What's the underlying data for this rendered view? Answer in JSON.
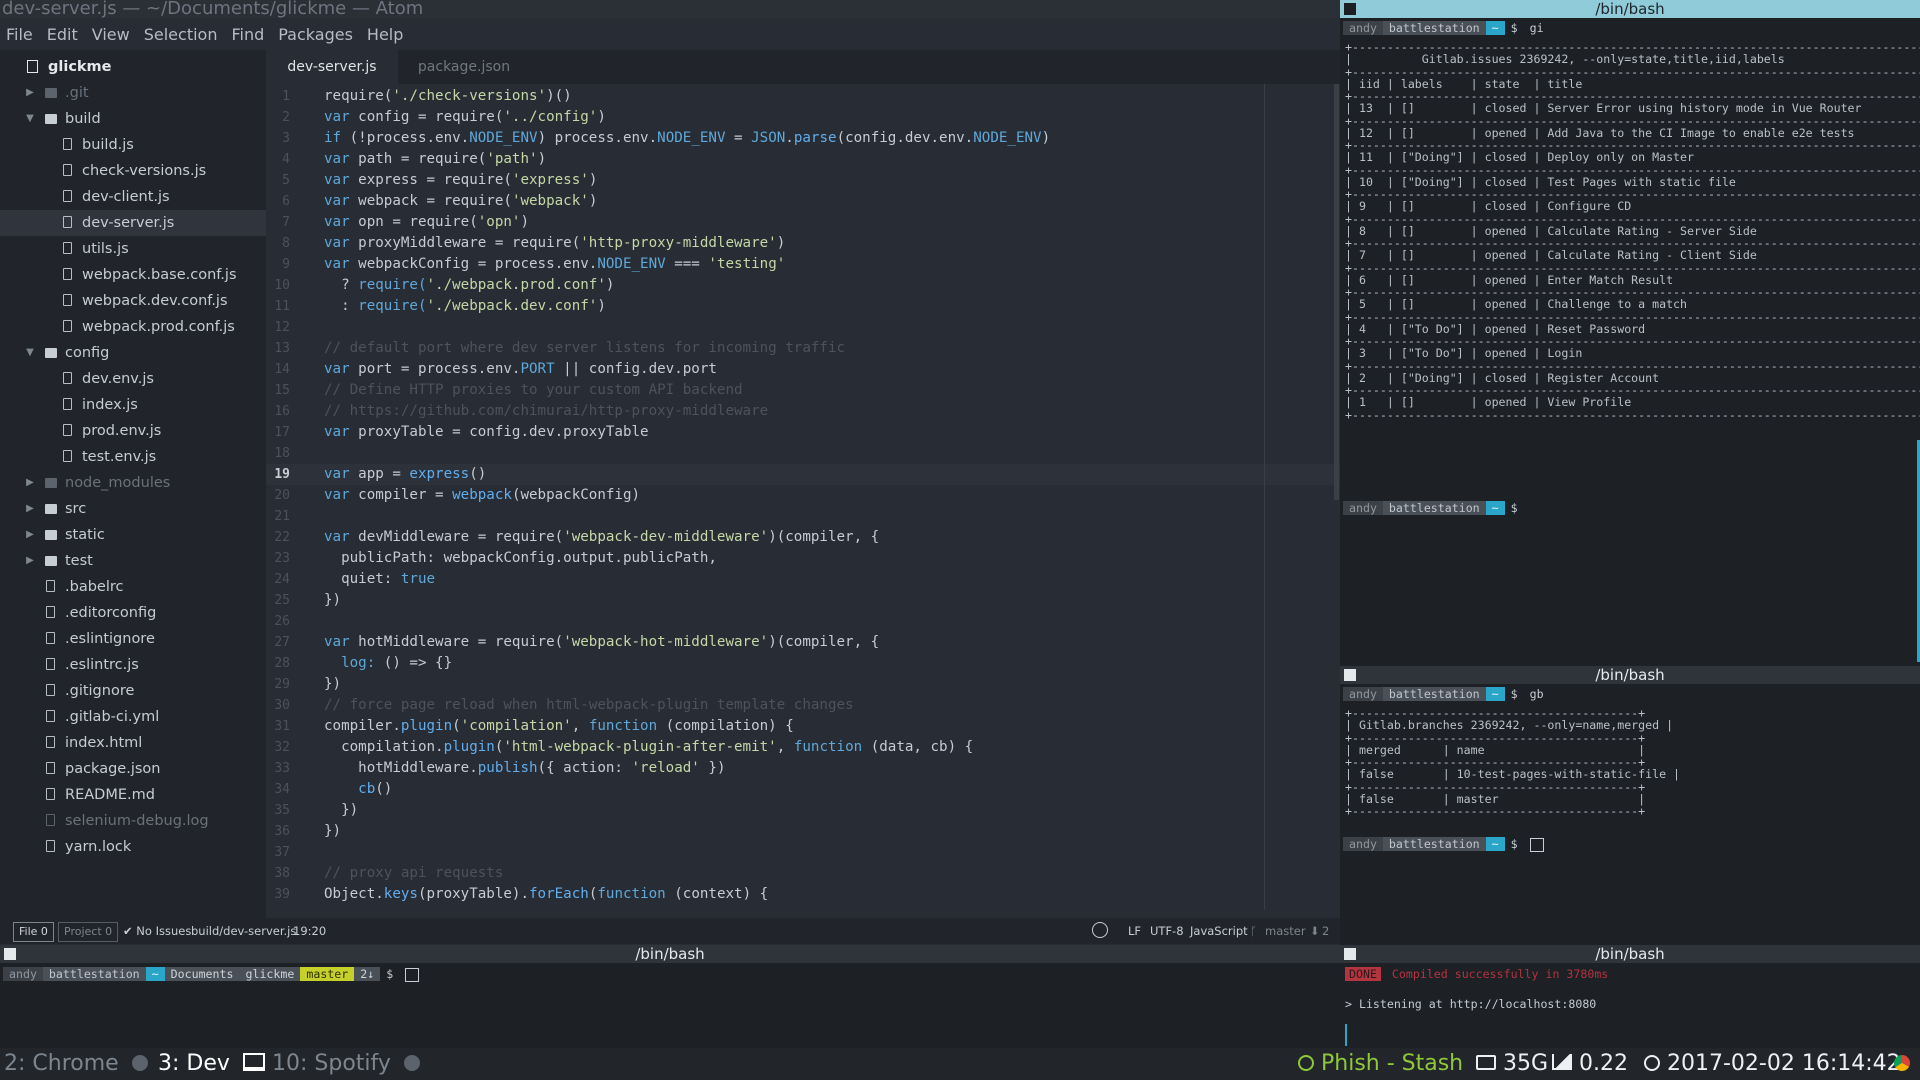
{
  "window": {
    "title": "dev-server.js — ~/Documents/glickme — Atom"
  },
  "menu": [
    "File",
    "Edit",
    "View",
    "Selection",
    "Find",
    "Packages",
    "Help"
  ],
  "tree": {
    "root": "glickme",
    "items": [
      {
        "label": ".git",
        "type": "folder",
        "depth": 1,
        "expanded": false,
        "dim": true
      },
      {
        "label": "build",
        "type": "folder",
        "depth": 1,
        "expanded": true
      },
      {
        "label": "build.js",
        "type": "file",
        "depth": 2
      },
      {
        "label": "check-versions.js",
        "type": "file",
        "depth": 2
      },
      {
        "label": "dev-client.js",
        "type": "file",
        "depth": 2
      },
      {
        "label": "dev-server.js",
        "type": "file",
        "depth": 2,
        "selected": true
      },
      {
        "label": "utils.js",
        "type": "file",
        "depth": 2
      },
      {
        "label": "webpack.base.conf.js",
        "type": "file",
        "depth": 2
      },
      {
        "label": "webpack.dev.conf.js",
        "type": "file",
        "depth": 2
      },
      {
        "label": "webpack.prod.conf.js",
        "type": "file",
        "depth": 2
      },
      {
        "label": "config",
        "type": "folder",
        "depth": 1,
        "expanded": true
      },
      {
        "label": "dev.env.js",
        "type": "file",
        "depth": 2
      },
      {
        "label": "index.js",
        "type": "file",
        "depth": 2
      },
      {
        "label": "prod.env.js",
        "type": "file",
        "depth": 2
      },
      {
        "label": "test.env.js",
        "type": "file",
        "depth": 2
      },
      {
        "label": "node_modules",
        "type": "folder",
        "depth": 1,
        "expanded": false,
        "dim": true
      },
      {
        "label": "src",
        "type": "folder",
        "depth": 1,
        "expanded": false
      },
      {
        "label": "static",
        "type": "folder",
        "depth": 1,
        "expanded": false
      },
      {
        "label": "test",
        "type": "folder",
        "depth": 1,
        "expanded": false
      },
      {
        "label": ".babelrc",
        "type": "file",
        "depth": 1
      },
      {
        "label": ".editorconfig",
        "type": "file",
        "depth": 1
      },
      {
        "label": ".eslintignore",
        "type": "file",
        "depth": 1
      },
      {
        "label": ".eslintrc.js",
        "type": "file",
        "depth": 1
      },
      {
        "label": ".gitignore",
        "type": "file",
        "depth": 1
      },
      {
        "label": ".gitlab-ci.yml",
        "type": "file",
        "depth": 1
      },
      {
        "label": "index.html",
        "type": "file",
        "depth": 1
      },
      {
        "label": "package.json",
        "type": "file",
        "depth": 1
      },
      {
        "label": "README.md",
        "type": "file",
        "depth": 1
      },
      {
        "label": "selenium-debug.log",
        "type": "file",
        "depth": 1,
        "dim": true
      },
      {
        "label": "yarn.lock",
        "type": "file",
        "depth": 1
      }
    ]
  },
  "tabs": [
    {
      "label": "dev-server.js",
      "active": true
    },
    {
      "label": "package.json",
      "active": false
    }
  ],
  "editor": {
    "current_line": 19,
    "lines": [
      [
        [
          "require(",
          "t"
        ],
        [
          "'./check-versions'",
          "s"
        ],
        [
          ")()",
          "t"
        ]
      ],
      [
        [
          "var ",
          "k"
        ],
        [
          "config = ",
          "t"
        ],
        [
          "require(",
          "t"
        ],
        [
          "'../config'",
          "s"
        ],
        [
          ")",
          "t"
        ]
      ],
      [
        [
          "if ",
          "k"
        ],
        [
          "(!process.env.",
          "t"
        ],
        [
          "NODE_ENV",
          "k"
        ],
        [
          ") process.env.",
          "t"
        ],
        [
          "NODE_ENV",
          "k"
        ],
        [
          " = ",
          "t"
        ],
        [
          "JSON",
          "k"
        ],
        [
          ".",
          "t"
        ],
        [
          "parse",
          "g"
        ],
        [
          "(config.dev.env.",
          "t"
        ],
        [
          "NODE_ENV",
          "k"
        ],
        [
          ")",
          "t"
        ]
      ],
      [
        [
          "var ",
          "k"
        ],
        [
          "path = ",
          "t"
        ],
        [
          "require(",
          "t"
        ],
        [
          "'path'",
          "s"
        ],
        [
          ")",
          "t"
        ]
      ],
      [
        [
          "var ",
          "k"
        ],
        [
          "express = ",
          "t"
        ],
        [
          "require(",
          "t"
        ],
        [
          "'express'",
          "s"
        ],
        [
          ")",
          "t"
        ]
      ],
      [
        [
          "var ",
          "k"
        ],
        [
          "webpack = ",
          "t"
        ],
        [
          "require(",
          "t"
        ],
        [
          "'webpack'",
          "s"
        ],
        [
          ")",
          "t"
        ]
      ],
      [
        [
          "var ",
          "k"
        ],
        [
          "opn = ",
          "t"
        ],
        [
          "require(",
          "t"
        ],
        [
          "'opn'",
          "s"
        ],
        [
          ")",
          "t"
        ]
      ],
      [
        [
          "var ",
          "k"
        ],
        [
          "proxyMiddleware = ",
          "t"
        ],
        [
          "require(",
          "t"
        ],
        [
          "'http-proxy-middleware'",
          "s"
        ],
        [
          ")",
          "t"
        ]
      ],
      [
        [
          "var ",
          "k"
        ],
        [
          "webpackConfig = process.env.",
          "t"
        ],
        [
          "NODE_ENV",
          "k"
        ],
        [
          " === ",
          "t"
        ],
        [
          "'testing'",
          "s"
        ]
      ],
      [
        [
          "  ? ",
          "t"
        ],
        [
          "require(",
          "k"
        ],
        [
          "'./webpack.prod.conf'",
          "s"
        ],
        [
          ")",
          "t"
        ]
      ],
      [
        [
          "  : ",
          "t"
        ],
        [
          "require(",
          "k"
        ],
        [
          "'./webpack.dev.conf'",
          "s"
        ],
        [
          ")",
          "t"
        ]
      ],
      [
        [
          "",
          "t"
        ]
      ],
      [
        [
          "// default port where dev server listens for incoming traffic",
          "c"
        ]
      ],
      [
        [
          "var ",
          "k"
        ],
        [
          "port = process.env.",
          "t"
        ],
        [
          "PORT",
          "k"
        ],
        [
          " || config.dev.port",
          "t"
        ]
      ],
      [
        [
          "// Define HTTP proxies to your custom API backend",
          "c"
        ]
      ],
      [
        [
          "// https://github.com/chimurai/http-proxy-middleware",
          "c"
        ]
      ],
      [
        [
          "var ",
          "k"
        ],
        [
          "proxyTable = config.dev.proxyTable",
          "t"
        ]
      ],
      [
        [
          "",
          "t"
        ]
      ],
      [
        [
          "var ",
          "k"
        ],
        [
          "app = ",
          "t"
        ],
        [
          "express",
          "g"
        ],
        [
          "()",
          "t"
        ]
      ],
      [
        [
          "var ",
          "k"
        ],
        [
          "compiler = ",
          "t"
        ],
        [
          "webpack",
          "g"
        ],
        [
          "(webpackConfig)",
          "t"
        ]
      ],
      [
        [
          "",
          "t"
        ]
      ],
      [
        [
          "var ",
          "k"
        ],
        [
          "devMiddleware = ",
          "t"
        ],
        [
          "require(",
          "t"
        ],
        [
          "'webpack-dev-middleware'",
          "s"
        ],
        [
          ")(compiler, {",
          "t"
        ]
      ],
      [
        [
          "  publicPath: webpackConfig.output.publicPath,",
          "t"
        ]
      ],
      [
        [
          "  quiet: ",
          "t"
        ],
        [
          "true",
          "k"
        ]
      ],
      [
        [
          "})",
          "t"
        ]
      ],
      [
        [
          "",
          "t"
        ]
      ],
      [
        [
          "var ",
          "k"
        ],
        [
          "hotMiddleware = ",
          "t"
        ],
        [
          "require(",
          "t"
        ],
        [
          "'webpack-hot-middleware'",
          "s"
        ],
        [
          ")(compiler, {",
          "t"
        ]
      ],
      [
        [
          "  log: ",
          "k"
        ],
        [
          "() => {}",
          "t"
        ]
      ],
      [
        [
          "})",
          "t"
        ]
      ],
      [
        [
          "// force page reload when html-webpack-plugin template changes",
          "c"
        ]
      ],
      [
        [
          "compiler.",
          "t"
        ],
        [
          "plugin",
          "g"
        ],
        [
          "(",
          "t"
        ],
        [
          "'compilation'",
          "s"
        ],
        [
          ", ",
          "t"
        ],
        [
          "function ",
          "k"
        ],
        [
          "(compilation) {",
          "t"
        ]
      ],
      [
        [
          "  compilation.",
          "t"
        ],
        [
          "plugin",
          "g"
        ],
        [
          "(",
          "t"
        ],
        [
          "'html-webpack-plugin-after-emit'",
          "s"
        ],
        [
          ", ",
          "t"
        ],
        [
          "function ",
          "k"
        ],
        [
          "(data, cb) {",
          "t"
        ]
      ],
      [
        [
          "    hotMiddleware.",
          "t"
        ],
        [
          "publish",
          "g"
        ],
        [
          "({ action: ",
          "t"
        ],
        [
          "'reload'",
          "s"
        ],
        [
          " })",
          "t"
        ]
      ],
      [
        [
          "    ",
          "t"
        ],
        [
          "cb",
          "g"
        ],
        [
          "()",
          "t"
        ]
      ],
      [
        [
          "  })",
          "t"
        ]
      ],
      [
        [
          "})",
          "t"
        ]
      ],
      [
        [
          "",
          "t"
        ]
      ],
      [
        [
          "// proxy api requests",
          "c"
        ]
      ],
      [
        [
          "Object.",
          "t"
        ],
        [
          "keys",
          "g"
        ],
        [
          "(proxyTable).",
          "t"
        ],
        [
          "forEach",
          "g"
        ],
        [
          "(",
          "t"
        ],
        [
          "function ",
          "k"
        ],
        [
          "(context) {",
          "t"
        ]
      ]
    ]
  },
  "status": {
    "file_count": "File 0",
    "project_count": "Project 0",
    "issues": "✔ No Issues",
    "path": "build/dev-server.js",
    "cursor": "19:20",
    "eol": "LF",
    "encoding": "UTF-8",
    "grammar": "JavaScript",
    "branch": "master",
    "ahead": "2"
  },
  "term_issues": {
    "title": "/bin/bash",
    "prompt_user": "andy",
    "prompt_host": "battlestation",
    "prompt_dir": "~",
    "command": "gi",
    "lines": [
      "+-----------------------------------------------------------------------------------------+",
      "|          Gitlab.issues 2369242, --only=state,title,iid,labels                          |",
      "+-----------------------------------------------------------------------------------------+",
      "| iid | labels    | state  | title                                                       |",
      "+-----------------------------------------------------------------------------------------+",
      "| 13  | []        | closed | Server Error using history mode in Vue Router               |",
      "+-----------------------------------------------------------------------------------------+",
      "| 12  | []        | opened | Add Java to the CI Image to enable e2e tests               |",
      "+-----------------------------------------------------------------------------------------+",
      "| 11  | [\"Doing\"] | closed | Deploy only on Master                                      |",
      "+-----------------------------------------------------------------------------------------+",
      "| 10  | [\"Doing\"] | closed | Test Pages with static file                                |",
      "+-----------------------------------------------------------------------------------------+",
      "| 9   | []        | closed | Configure CD                                               |",
      "+-----------------------------------------------------------------------------------------+",
      "| 8   | []        | opened | Calculate Rating - Server Side                             |",
      "+-----------------------------------------------------------------------------------------+",
      "| 7   | []        | opened | Calculate Rating - Client Side                             |",
      "+-----------------------------------------------------------------------------------------+",
      "| 6   | []        | opened | Enter Match Result                                         |",
      "+-----------------------------------------------------------------------------------------+",
      "| 5   | []        | opened | Challenge to a match                                       |",
      "+-----------------------------------------------------------------------------------------+",
      "| 4   | [\"To Do\"] | opened | Reset Password                                             |",
      "+-----------------------------------------------------------------------------------------+",
      "| 3   | [\"To Do\"] | opened | Login                                                      |",
      "+-----------------------------------------------------------------------------------------+",
      "| 2   | [\"Doing\"] | closed | Register Account                                           |",
      "+-----------------------------------------------------------------------------------------+",
      "| 1   | []        | opened | View Profile                                               |",
      "+-----------------------------------------------------------------------------------------+"
    ]
  },
  "term_branches": {
    "title": "/bin/bash",
    "command": "gb",
    "lines": [
      "+-----------------------------------------+",
      "| Gitlab.branches 2369242, --only=name,merged |",
      "+-----------------------------------------+",
      "| merged      | name                      |",
      "+-----------------------------------------+",
      "| false       | 10-test-pages-with-static-file |",
      "+-----------------------------------------+",
      "| false       | master                    |",
      "+-----------------------------------------+"
    ]
  },
  "term_left": {
    "title": "/bin/bash",
    "prompt_segments": [
      "andy",
      "battlestation",
      "~",
      "Documents",
      "glickme",
      "master",
      "2↓"
    ]
  },
  "term_right": {
    "title": "/bin/bash",
    "done_badge": "DONE",
    "done_msg": "Compiled successfully in 3780ms",
    "listening": "> Listening at http://localhost:8080"
  },
  "bottom": {
    "workspaces": [
      {
        "label": "2: Chrome",
        "active": false
      },
      {
        "label": "3: Dev",
        "active": true
      },
      {
        "label": "10: Spotify",
        "active": false
      }
    ],
    "music": "Phish - Stash",
    "disk": "35G",
    "load": "0.22",
    "datetime": "2017-02-02 16:14:42"
  }
}
